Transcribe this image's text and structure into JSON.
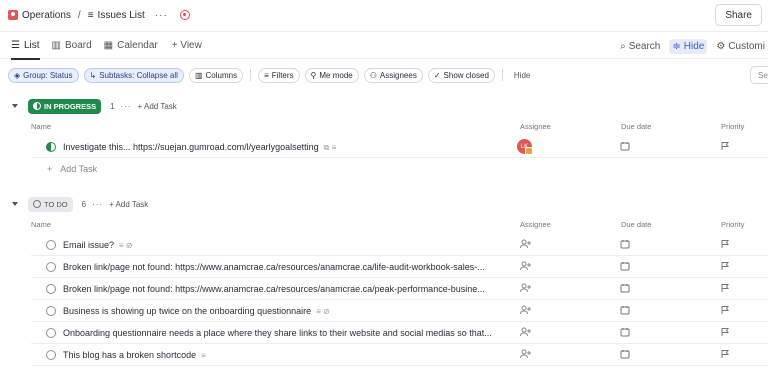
{
  "breadcrumb": {
    "space": "Operations",
    "list": "Issues List"
  },
  "share_label": "Share",
  "views": [
    {
      "label": "List",
      "active": true
    },
    {
      "label": "Board",
      "active": false
    },
    {
      "label": "Calendar",
      "active": false
    }
  ],
  "add_view_label": "+ View",
  "view_right": {
    "search": "Search",
    "hide": "Hide",
    "customize": "Customi"
  },
  "filters": {
    "group": "Group: Status",
    "subtasks": "Subtasks: Collapse all",
    "columns": "Columns",
    "filters": "Filters",
    "me_mode": "Me mode",
    "assignees": "Assignees",
    "show_closed": "Show closed",
    "hide": "Hide",
    "search_placeholder": "Se"
  },
  "columns": {
    "name": "Name",
    "assignee": "Assignee",
    "due": "Due date",
    "priority": "Priority"
  },
  "groups": [
    {
      "status": "IN PROGRESS",
      "count": "1",
      "add_task": "Add Task",
      "color": "#1f8a4c",
      "tasks": [
        {
          "title": "Investigate this... https://suejan.gumroad.com/l/yearlygoalsetting",
          "avatar": "LK"
        }
      ],
      "add_row": "Add Task"
    },
    {
      "status": "TO DO",
      "count": "6",
      "add_task": "Add Task",
      "color": "#e8e9ec",
      "tasks": [
        {
          "title": "Email issue?"
        },
        {
          "title": "Broken link/page not found: https://www.anamcrae.ca/resources/anamcrae.ca/life-audit-workbook-sales-..."
        },
        {
          "title": "Broken link/page not found: https://www.anamcrae.ca/resources/anamcrae.ca/peak-performance-busine..."
        },
        {
          "title": "Business is showing up twice on the onboarding questionnaire"
        },
        {
          "title": "Onboarding questionnaire needs a place where they share links to their website and social medias so that..."
        },
        {
          "title": "This blog has a broken shortcode"
        }
      ]
    }
  ]
}
